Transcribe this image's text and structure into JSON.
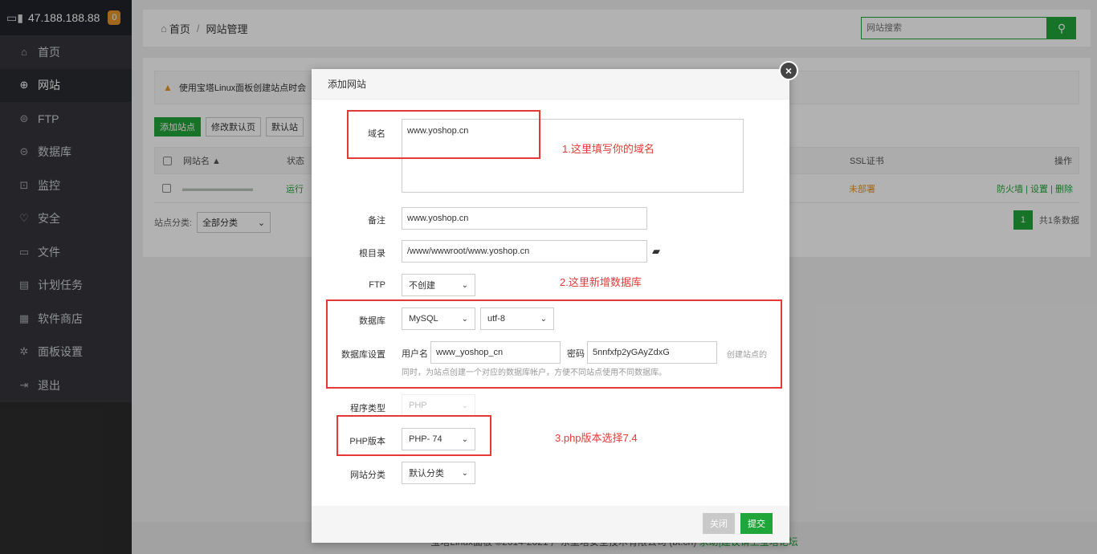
{
  "sidebar": {
    "server_ip": "47.188.188.88",
    "badge": "0",
    "items": [
      {
        "label": "首页",
        "icon": "home-icon",
        "glyph": "⌂"
      },
      {
        "label": "网站",
        "icon": "globe-icon",
        "glyph": "⊕"
      },
      {
        "label": "FTP",
        "icon": "ftp-icon",
        "glyph": "⊜"
      },
      {
        "label": "数据库",
        "icon": "database-icon",
        "glyph": "⊝"
      },
      {
        "label": "监控",
        "icon": "monitor-icon",
        "glyph": "⊡"
      },
      {
        "label": "安全",
        "icon": "shield-icon",
        "glyph": "♡"
      },
      {
        "label": "文件",
        "icon": "folder-icon",
        "glyph": "▭"
      },
      {
        "label": "计划任务",
        "icon": "calendar-icon",
        "glyph": "▤"
      },
      {
        "label": "软件商店",
        "icon": "apps-icon",
        "glyph": "▦"
      },
      {
        "label": "面板设置",
        "icon": "gear-icon",
        "glyph": "✲"
      },
      {
        "label": "退出",
        "icon": "logout-icon",
        "glyph": "⇥"
      }
    ]
  },
  "header": {
    "home": "首页",
    "sep": "/",
    "current": "网站管理",
    "search_placeholder": "网站搜索"
  },
  "panel": {
    "warning": "使用宝塔Linux面板创建站点时会",
    "toolbar": {
      "add": "添加站点",
      "edit_default": "修改默认页",
      "default_site": "默认站"
    },
    "table": {
      "headers": {
        "name": "网站名 ▲",
        "status": "状态",
        "ssl": "SSL证书",
        "ops": "操作"
      },
      "row": {
        "name": "▬▬▬▬▬▬▬▬",
        "status": "运行",
        "ssl": "未部署",
        "ops": "防火墙 | 设置 | 删除"
      }
    },
    "category_label": "站点分类:",
    "category_value": "全部分类",
    "page_current": "1",
    "page_total": "共1条数据"
  },
  "footer_copy": {
    "text": "宝塔Linux面板 ©2014-2021 广东堡塔安全技术有限公司 (bt.cn)",
    "link": "求助|建议请上宝塔论坛"
  },
  "modal": {
    "title": "添加网站",
    "close": "×",
    "domain_label": "域名",
    "domain_value": "www.yoshop.cn",
    "remark_label": "备注",
    "remark_value": "www.yoshop.cn",
    "root_label": "根目录",
    "root_value": "/www/wwwroot/www.yoshop.cn",
    "ftp_label": "FTP",
    "ftp_value": "不创建",
    "db_label": "数据库",
    "db_type": "MySQL",
    "db_charset": "utf-8",
    "db_settings_label": "数据库设置",
    "db_user_label": "用户名",
    "db_user_value": "www_yoshop_cn",
    "db_pass_label": "密码",
    "db_pass_value": "5nnfxfp2yGAyZdxG",
    "db_hint_a": "创建站点的",
    "db_hint_b": "同时，为站点创建一个对应的数据库帐户，方便不同站点使用不同数据库。",
    "prog_label": "程序类型",
    "prog_value": "PHP",
    "php_label": "PHP版本",
    "php_value": "PHP- 74",
    "cat_label": "网站分类",
    "cat_value": "默认分类",
    "btn_close": "关闭",
    "btn_submit": "提交"
  },
  "annotations": {
    "note1": "1.这里填写你的域名",
    "note2": "2.这里新增数据库",
    "note3": "3.php版本选择7.4"
  },
  "colors": {
    "accent": "#20a53a",
    "annotation": "#e53935"
  }
}
